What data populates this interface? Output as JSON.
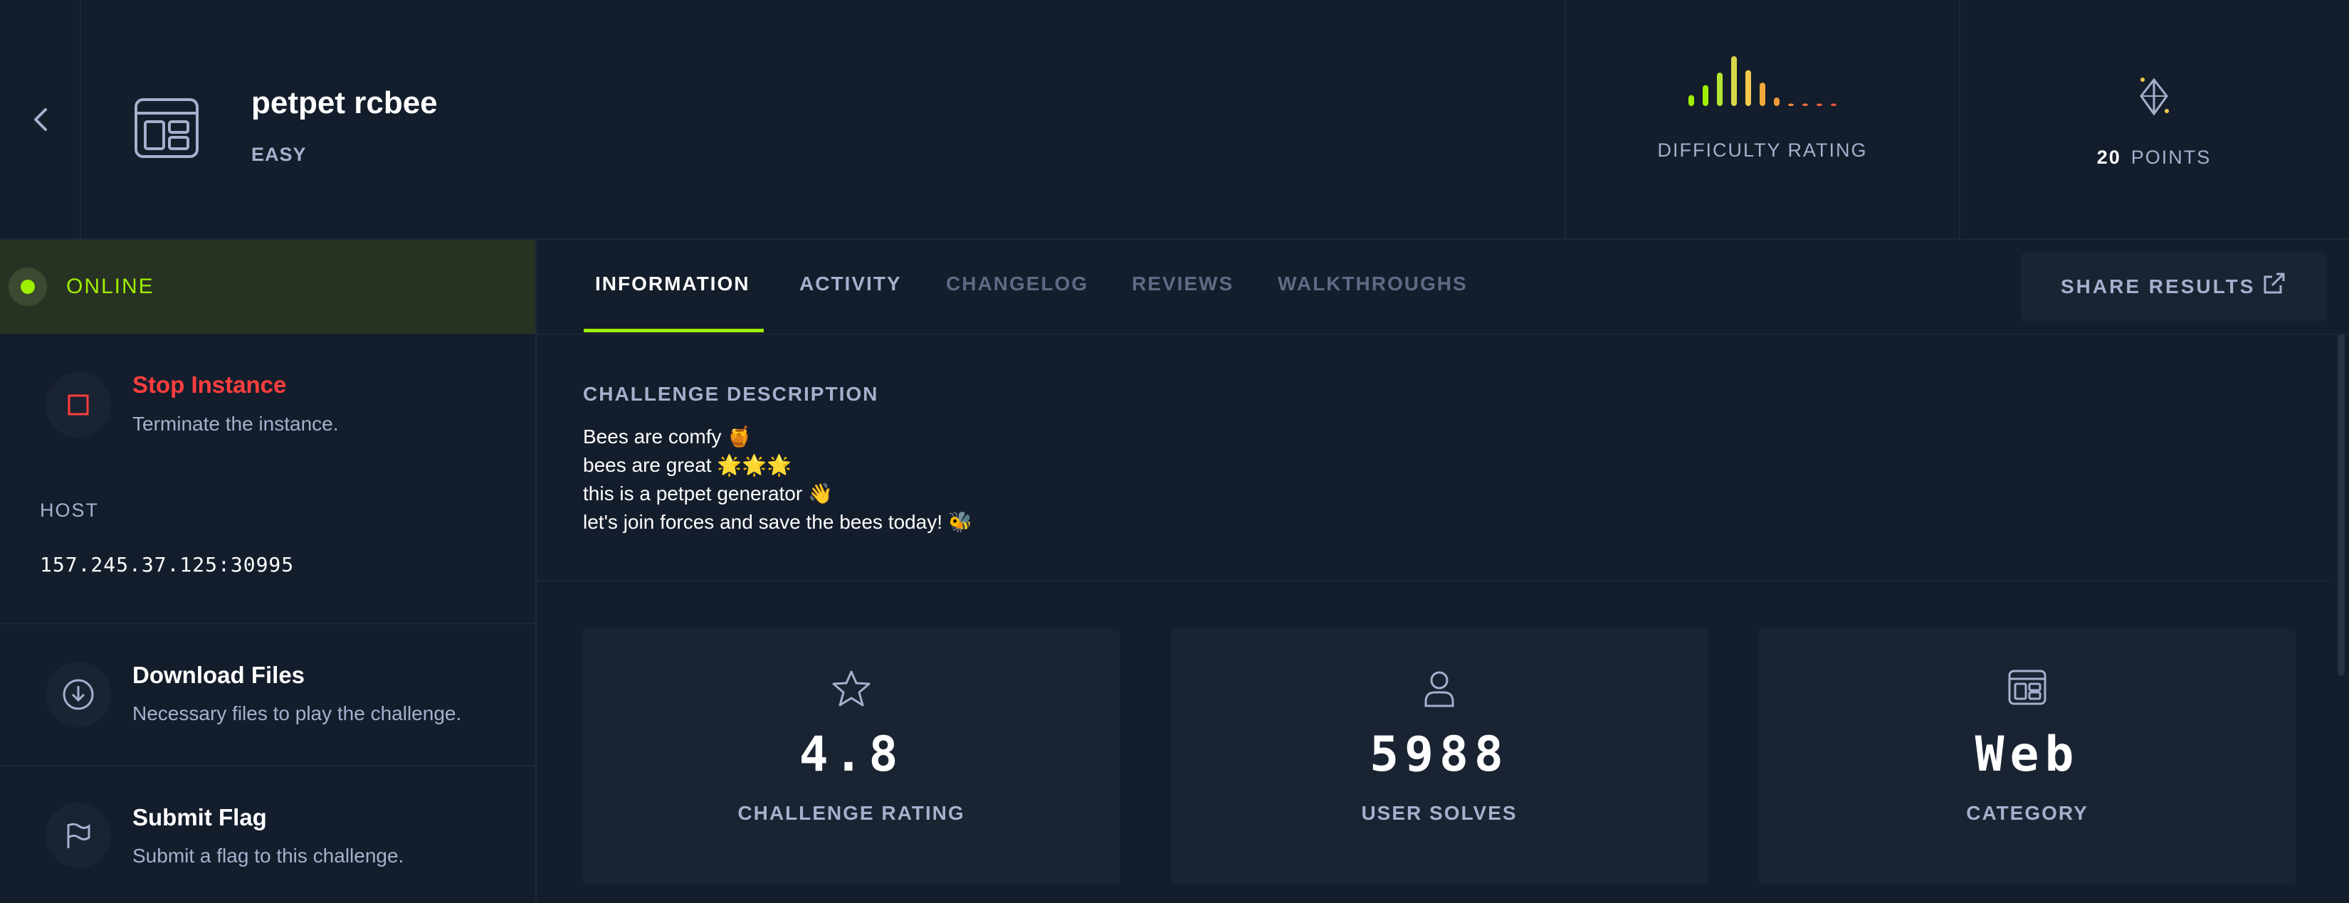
{
  "challenge": {
    "name": "petpet rcbee",
    "difficulty": "EASY"
  },
  "difficulty_rating": {
    "label": "DIFFICULTY RATING",
    "bars": [
      {
        "height": 0.22,
        "color": "#9fef00"
      },
      {
        "height": 0.42,
        "color": "#9fef00"
      },
      {
        "height": 0.67,
        "color": "#b6e634"
      },
      {
        "height": 1.0,
        "color": "#d8d84b"
      },
      {
        "height": 0.72,
        "color": "#f2c94c"
      },
      {
        "height": 0.47,
        "color": "#f2a93c"
      },
      {
        "height": 0.17,
        "color": "#f29a3c"
      },
      {
        "height": 0.05,
        "color": "#f28a3c"
      },
      {
        "height": 0.05,
        "color": "#f2703c"
      },
      {
        "height": 0.05,
        "color": "#f0603c"
      },
      {
        "height": 0.05,
        "color": "#ee533c"
      }
    ]
  },
  "points": {
    "value": "20",
    "label": "POINTS"
  },
  "instance": {
    "status": "ONLINE",
    "stop_title": "Stop Instance",
    "stop_subtitle": "Terminate the instance.",
    "host_label": "HOST",
    "host_value": "157.245.37.125:30995"
  },
  "actions": {
    "download_title": "Download Files",
    "download_subtitle": "Necessary files to play the challenge.",
    "submit_title": "Submit Flag",
    "submit_subtitle": "Submit a flag to this challenge."
  },
  "tabs": {
    "information": "INFORMATION",
    "activity": "ACTIVITY",
    "changelog": "CHANGELOG",
    "reviews": "REVIEWS",
    "walkthroughs": "WALKTHROUGHS",
    "share": "SHARE RESULTS"
  },
  "description": {
    "heading": "CHALLENGE DESCRIPTION",
    "lines": [
      "Bees are comfy 🍯",
      "bees are great 🌟🌟🌟",
      "this is a petpet generator 👋",
      "let's join forces and save the bees today! 🐝"
    ]
  },
  "stats": {
    "rating_value": "4.8",
    "rating_label": "CHALLENGE RATING",
    "solves_value": "5988",
    "solves_label": "USER SOLVES",
    "category_value": "Web",
    "category_label": "CATEGORY"
  },
  "colors": {
    "background": "#141d2b",
    "card": "#1a2332",
    "accent_green": "#9fef00",
    "danger_red": "#ff3e3e",
    "muted_text": "#a4b1cd"
  }
}
